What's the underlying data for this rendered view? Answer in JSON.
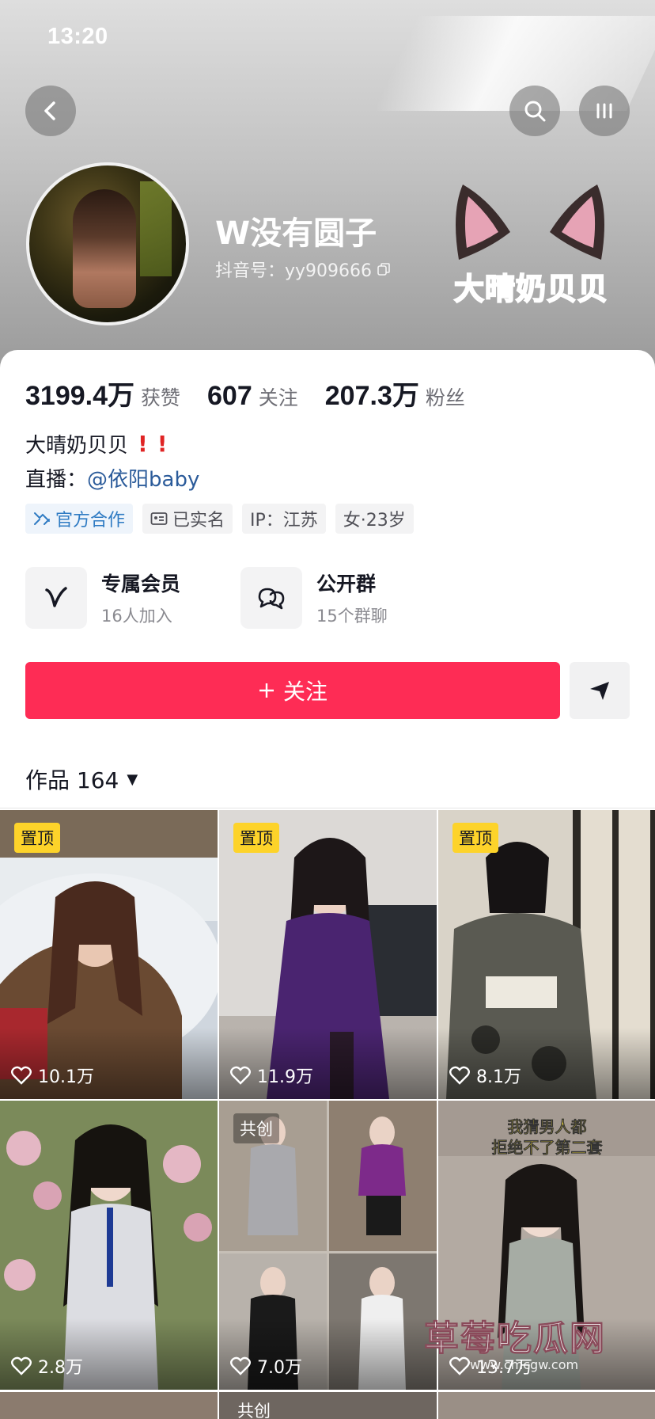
{
  "status_bar": {
    "time": "13:20"
  },
  "profile": {
    "name": "W没有圆子",
    "douyin_id": "抖音号：yy909666",
    "sticker_text": "大晴奶贝贝"
  },
  "stats": [
    {
      "value": "3199.4万",
      "label": "获赞"
    },
    {
      "value": "607",
      "label": "关注"
    },
    {
      "value": "207.3万",
      "label": "粉丝"
    }
  ],
  "bio": {
    "line1": "大晴奶贝贝",
    "live_prefix": "直播：",
    "live_link": "@依阳baby"
  },
  "tags": {
    "official": "官方合作",
    "verified": "已实名",
    "ip": "IP：江苏",
    "gender_age": "女·23岁"
  },
  "features": {
    "members": {
      "title": "专属会员",
      "subtitle": "16人加入"
    },
    "groups": {
      "title": "公开群",
      "subtitle": "15个群聊"
    }
  },
  "actions": {
    "follow": "关注"
  },
  "works": {
    "label": "作品 164"
  },
  "tiles": [
    {
      "badge": "置顶",
      "likes": "10.1万"
    },
    {
      "badge": "置顶",
      "likes": "11.9万"
    },
    {
      "badge": "置顶",
      "likes": "8.1万"
    },
    {
      "badge": "",
      "likes": "2.8万"
    },
    {
      "badge": "共创",
      "likes": "7.0万"
    },
    {
      "badge": "",
      "likes": "13.7万",
      "caption": "我猜男人都\n拒绝不了第二套"
    }
  ],
  "watermark": {
    "text": "草莓吃瓜网",
    "url": "www.cmcgw.com"
  },
  "bottom_partial": {
    "collab": "共创"
  },
  "colors": {
    "accent": "#fe2c55",
    "link": "#2b5b9a",
    "pin_badge": "#fdd32a"
  }
}
